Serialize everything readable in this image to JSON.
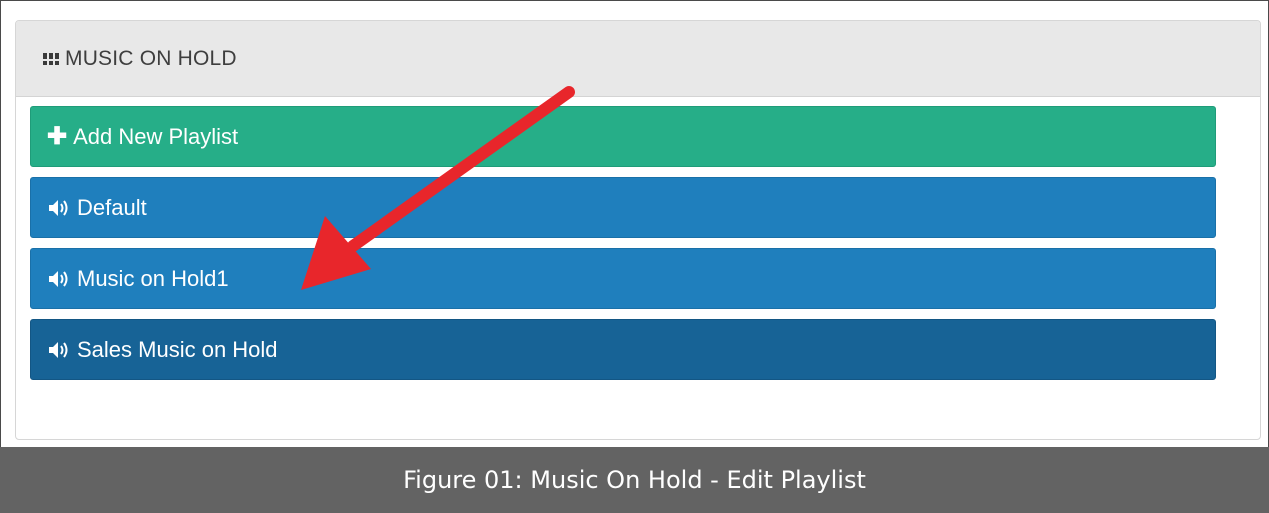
{
  "panel": {
    "title": "MUSIC ON HOLD",
    "icon": "grid-icon"
  },
  "buttons": {
    "add_new": {
      "label": "Add New Playlist",
      "icon": "plus-icon",
      "color": "#26ae88"
    },
    "default": {
      "label": "Default",
      "icon": "speaker-icon",
      "color": "#1f7fbd"
    },
    "moh1": {
      "label": "Music on Hold1",
      "icon": "speaker-icon",
      "color": "#1f7fbd"
    },
    "sales": {
      "label": "Sales Music on Hold",
      "icon": "speaker-icon",
      "color": "#176396"
    }
  },
  "annotation": {
    "arrow_color": "#e8262b",
    "arrow_target": "Music on Hold1"
  },
  "caption": {
    "text": "Figure 01: Music On Hold - Edit Playlist"
  }
}
